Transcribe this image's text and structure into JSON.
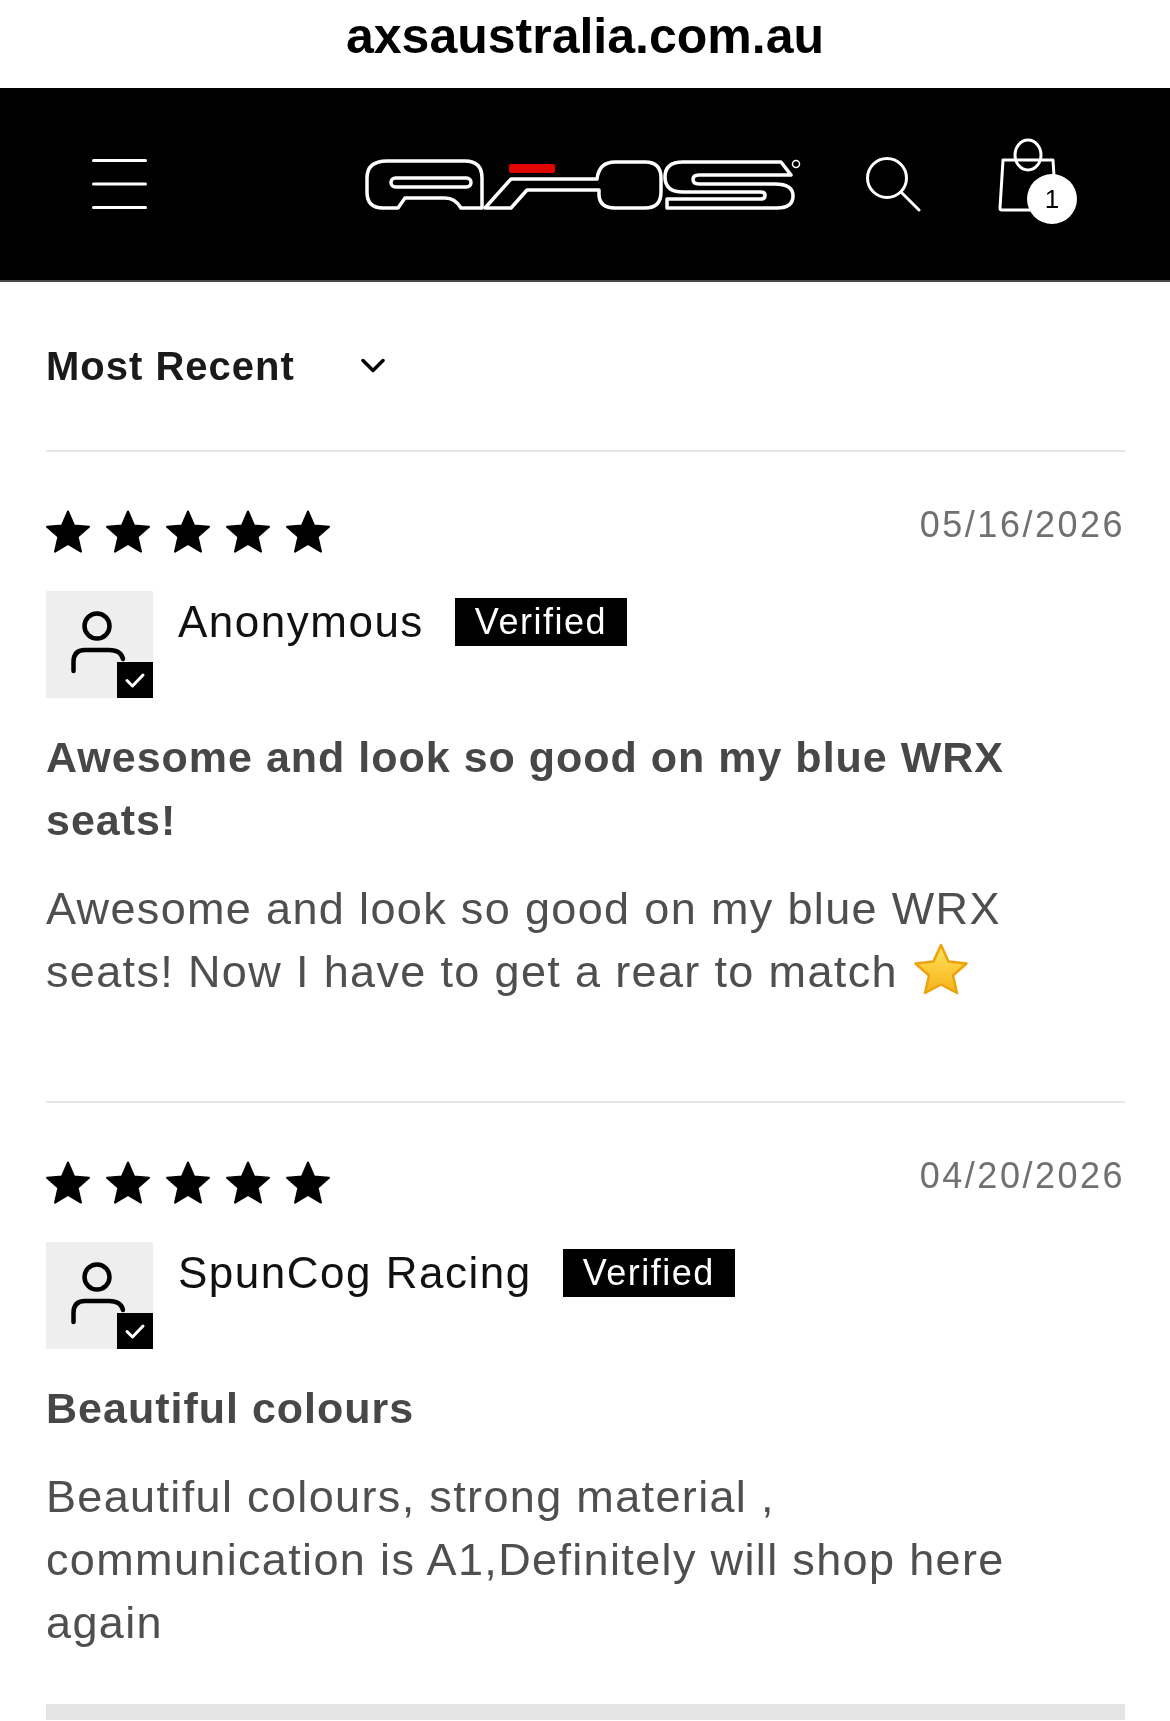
{
  "browser": {
    "url": "axsaustralia.com.au"
  },
  "header": {
    "cart_count": "1"
  },
  "sort": {
    "label": "Most Recent"
  },
  "reviews": [
    {
      "stars": 5,
      "date": "05/16/2026",
      "author": "Anonymous",
      "verified": true,
      "badge": "Verified",
      "title": "Awesome and look so good on my blue WRX seats!",
      "body": "Awesome and look so good on my blue WRX seats! Now I have to get a rear to match",
      "trailing_emoji": true
    },
    {
      "stars": 5,
      "date": "04/20/2026",
      "author": "SpunCog Racing",
      "verified": true,
      "badge": "Verified",
      "title": "Beautiful colours",
      "body": "Beautiful colours, strong material , communication is A1,Definitely will shop here again",
      "trailing_emoji": false
    }
  ]
}
